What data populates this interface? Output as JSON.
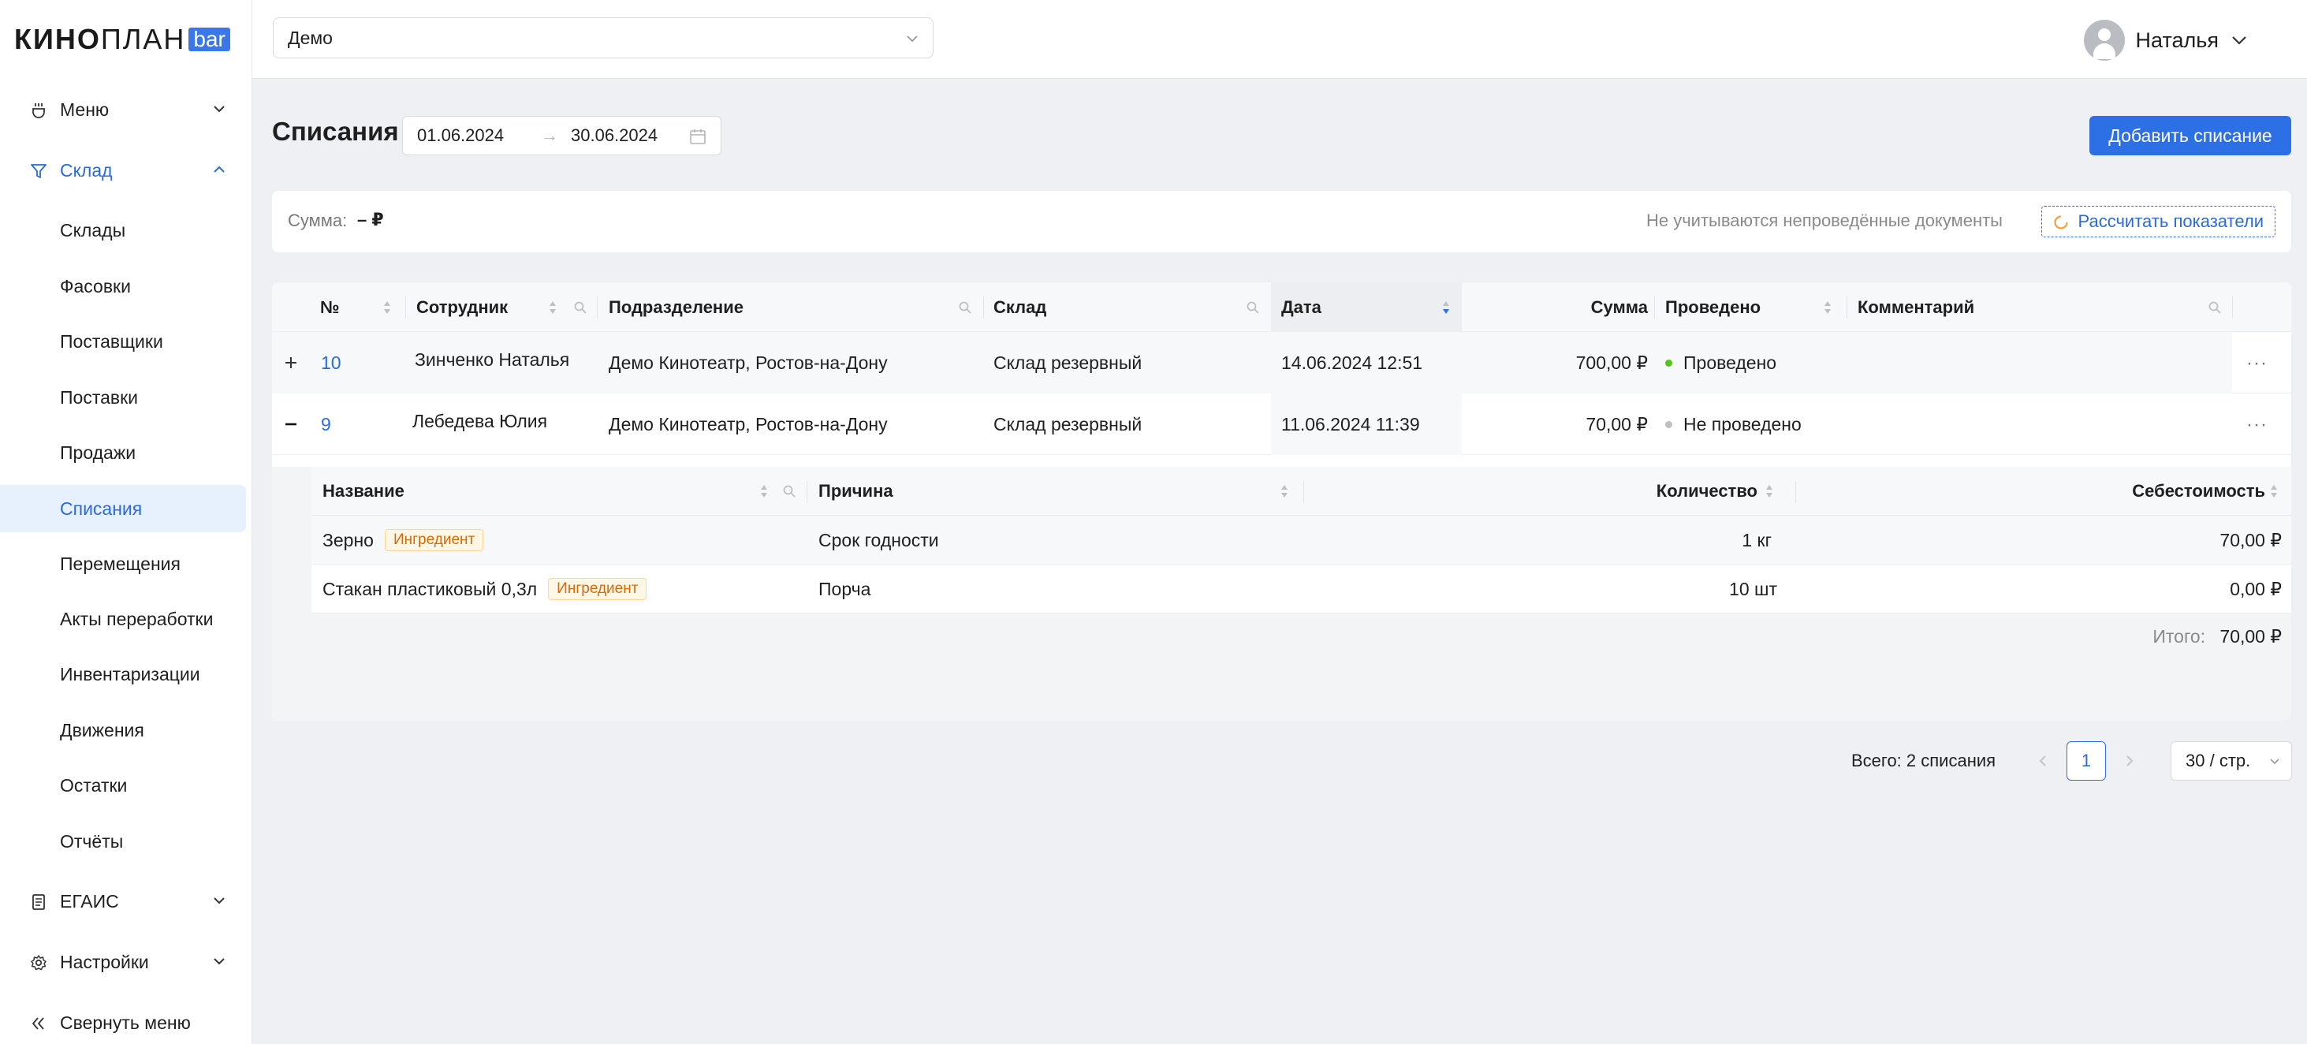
{
  "brand": {
    "part1": "КИНО",
    "part2": "ПЛАН",
    "part3": "bar"
  },
  "sidebar": {
    "groups": {
      "menu": "Меню",
      "stock": "Склад",
      "egais": "ЕГАИС",
      "settings": "Настройки",
      "collapse": "Свернуть меню"
    },
    "stock_items": [
      "Склады",
      "Фасовки",
      "Поставщики",
      "Поставки",
      "Продажи",
      "Списания",
      "Перемещения",
      "Акты переработки",
      "Инвентаризации",
      "Движения",
      "Остатки",
      "Отчёты"
    ],
    "selected": "Списания"
  },
  "topbar": {
    "organization": "Демо",
    "user_name": "Наталья"
  },
  "page": {
    "title": "Списания",
    "date_from": "01.06.2024",
    "date_to": "30.06.2024",
    "date_arrow": "→",
    "add_button": "Добавить списание"
  },
  "summary": {
    "label": "Сумма:",
    "value": "– ₽",
    "note": "Не учитываются непроведённые документы",
    "recalc_button": "Рассчитать показатели"
  },
  "table": {
    "columns": [
      "№",
      "Сотрудник",
      "Подразделение",
      "Склад",
      "Дата",
      "Сумма",
      "Проведено",
      "Комментарий"
    ],
    "rows": [
      {
        "num": "10",
        "employee": "Зинченко Наталья",
        "division": "Демо Кинотеатр, Ростов-на-Дону",
        "warehouse": "Склад резервный",
        "date": "14.06.2024 12:51",
        "sum": "700,00 ₽",
        "status": "Проведено",
        "status_color": "#52c41a",
        "comment": "",
        "expander": "+"
      },
      {
        "num": "9",
        "employee": "Лебедева Юлия",
        "division": "Демо Кинотеатр, Ростов-на-Дону",
        "warehouse": "Склад резервный",
        "date": "11.06.2024 11:39",
        "sum": "70,00 ₽",
        "status": "Не проведено",
        "status_color": "#bfbfbf",
        "comment": "",
        "expander": "–"
      }
    ],
    "more": "···"
  },
  "nested": {
    "columns": [
      "Название",
      "Причина",
      "Количество",
      "Себестоимость"
    ],
    "rows": [
      {
        "name": "Зерно",
        "tag": "Ингредиент",
        "reason": "Срок годности",
        "qty": "1 кг",
        "cost": "70,00 ₽"
      },
      {
        "name": "Стакан пластиковый 0,3л",
        "tag": "Ингредиент",
        "reason": "Порча",
        "qty": "10 шт",
        "cost": "0,00 ₽"
      }
    ],
    "total_label": "Итого:",
    "total_value": "70,00 ₽"
  },
  "pagination": {
    "total": "Всего: 2 списания",
    "page": "1",
    "page_size": "30 / стр."
  },
  "colors": {
    "accent": "#2d6fe4",
    "selected_bg": "#e7f0fd",
    "page_bg": "#eef0f3",
    "tag": "#d46b08"
  }
}
